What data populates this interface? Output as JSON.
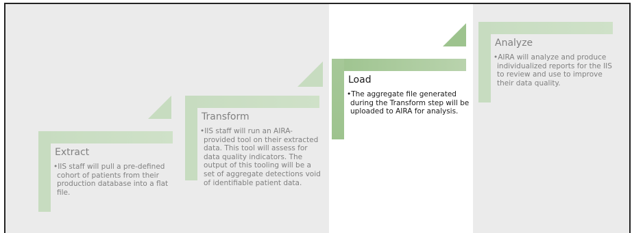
{
  "colors": {
    "panel_grey": "#ebebeb",
    "panel_white": "#ffffff",
    "shape_fill_light": "#c7dcc0",
    "shape_fill_dark": "#9dc38e",
    "text_grey": "#808080",
    "text_dark": "#1a1a1a"
  },
  "steps": [
    {
      "title": "Extract",
      "bullet": "•",
      "description": "IIS staff will pull a pre-defined cohort of patients from their production database into a flat file."
    },
    {
      "title": "Transform",
      "bullet": "•",
      "description": "IIS staff will run an AIRA-provided tool on their extracted data. This tool will assess for data quality indicators. The output of this tooling will be a set of aggregate detections void of identifiable patient data."
    },
    {
      "title": "Load",
      "bullet": "•",
      "description": "The aggregate file generated during the Transform step will be uploaded to AIRA for analysis."
    },
    {
      "title": "Analyze",
      "bullet": "•",
      "description": "AIRA will analyze and produce individualized reports for the IIS to review and use to improve their data quality."
    }
  ]
}
